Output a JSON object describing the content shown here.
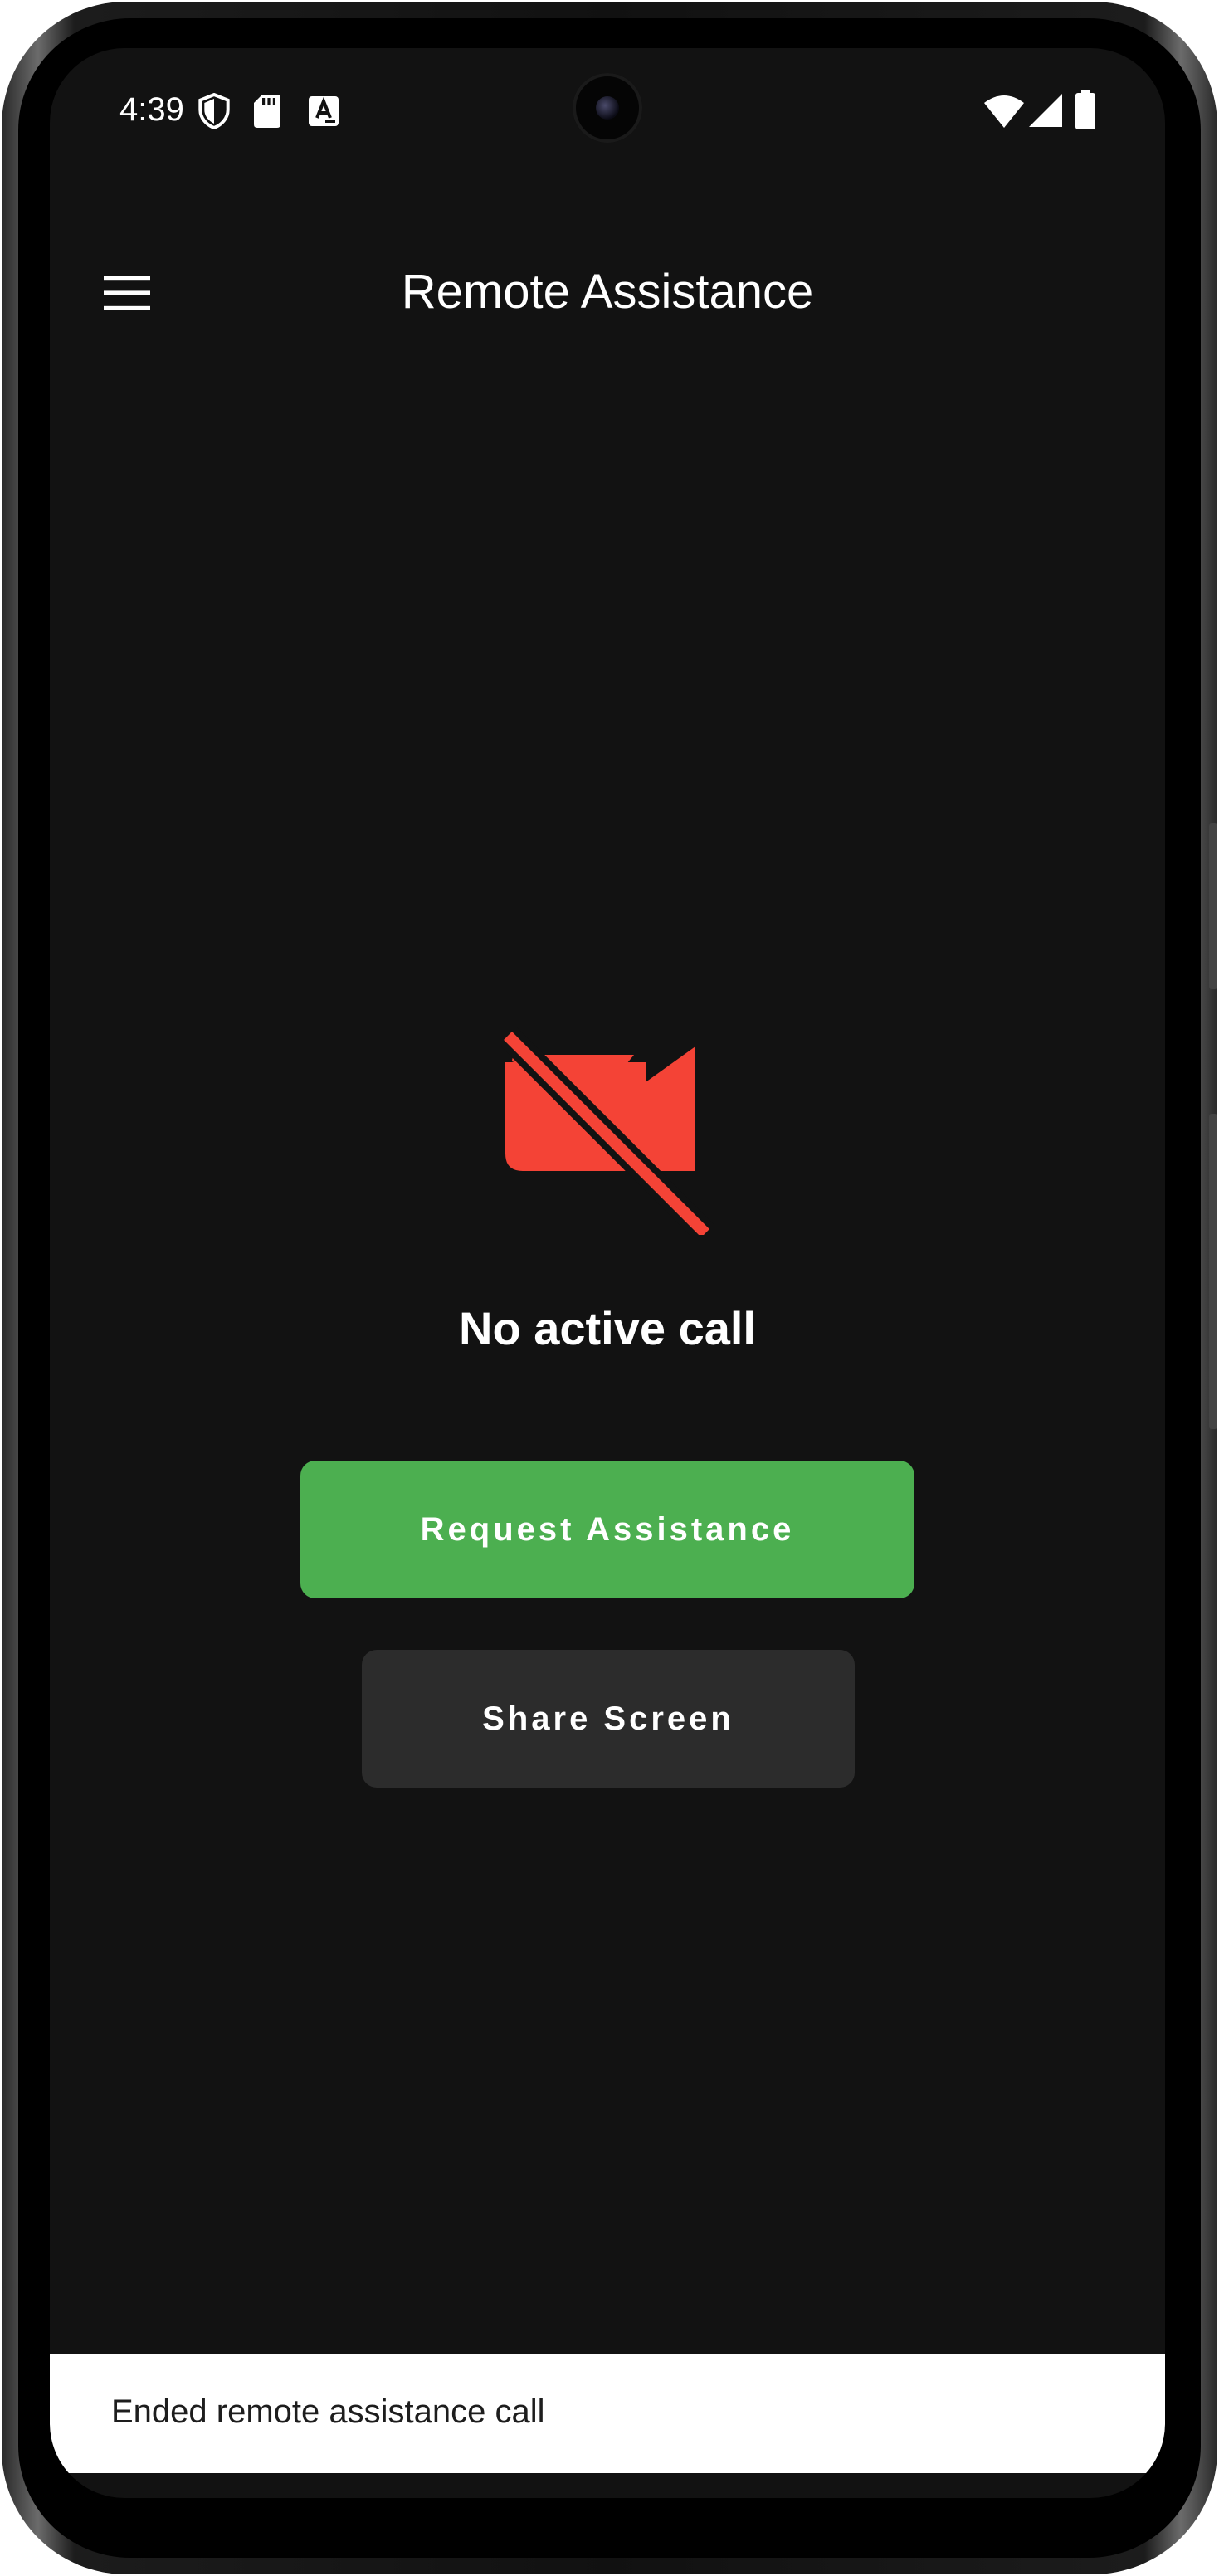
{
  "status_bar": {
    "time": "4:39",
    "icons_left": [
      "shield-icon",
      "sd-card-icon",
      "keyboard-a-icon"
    ],
    "icons_right": [
      "wifi-icon",
      "cell-signal-icon",
      "battery-icon"
    ]
  },
  "app_bar": {
    "title": "Remote Assistance",
    "menu_icon": "hamburger-menu-icon"
  },
  "main": {
    "status_icon": "videocam-off-icon",
    "status_icon_color": "#F44336",
    "status_text": "No active call",
    "request_button_label": "Request Assistance",
    "request_button_color": "#4CAF50",
    "share_button_label": "Share Screen",
    "share_button_color": "#2C2C2C"
  },
  "snackbar": {
    "message": "Ended remote assistance call"
  },
  "colors": {
    "background": "#121212",
    "text": "#FFFFFF"
  }
}
